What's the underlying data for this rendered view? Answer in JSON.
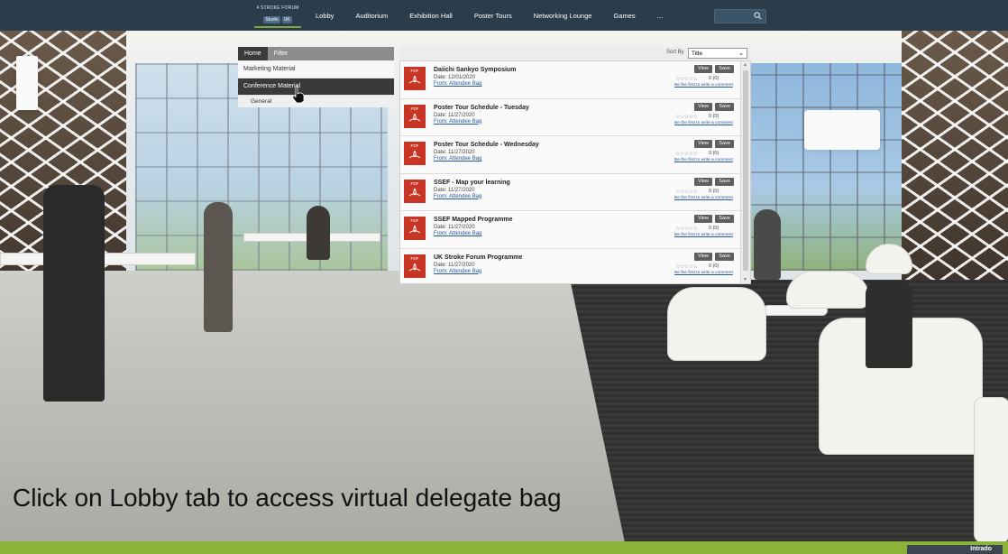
{
  "topnav": {
    "event_logo_text": "4 STROKE FORUM",
    "event_badges": [
      "Studio",
      "UK"
    ],
    "items": [
      {
        "label": "Lobby"
      },
      {
        "label": "Auditorium"
      },
      {
        "label": "Exhibition Hall"
      },
      {
        "label": "Poster Tours"
      },
      {
        "label": "Networking Lounge"
      },
      {
        "label": "Games"
      }
    ],
    "more_label": "...",
    "search_icon": "search-icon"
  },
  "bag": {
    "tabs": [
      {
        "label": "Home",
        "active": true
      },
      {
        "label": "Filter",
        "active": false
      }
    ],
    "menu": [
      {
        "label": "Marketing Material",
        "selected": false
      },
      {
        "label": "Conference Material",
        "selected": true
      }
    ],
    "submenu": [
      {
        "label": "General"
      }
    ]
  },
  "sort": {
    "label": "Sort By",
    "value": "Title"
  },
  "files": [
    {
      "title": "Daiichi Sankyo Symposium",
      "date": "Date: 12/01/2020",
      "from": "From: Attendee Bag",
      "rating": "0 (0)",
      "comment": "Be the first to write a comment"
    },
    {
      "title": "Poster Tour Schedule - Tuesday",
      "date": "Date: 11/27/2020",
      "from": "From: Attendee Bag",
      "rating": "0 (0)",
      "comment": "Be the first to write a comment"
    },
    {
      "title": "Poster Tour Schedule - Wednesday",
      "date": "Date: 11/27/2020",
      "from": "From: Attendee Bag",
      "rating": "0 (0)",
      "comment": "Be the first to write a comment"
    },
    {
      "title": "SSEF - Map your learning",
      "date": "Date: 11/27/2020",
      "from": "From: Attendee Bag",
      "rating": "0 (0)",
      "comment": "Be the first to write a comment"
    },
    {
      "title": "SSEF Mapped Programme",
      "date": "Date: 11/27/2020",
      "from": "From: Attendee Bag",
      "rating": "0 (0)",
      "comment": "Be the first to write a comment"
    },
    {
      "title": "UK Stroke Forum Programme",
      "date": "Date: 11/27/2020",
      "from": "From: Attendee Bag",
      "rating": "0 (0)",
      "comment": "Be the first to write a comment"
    }
  ],
  "file_buttons": {
    "view": "View",
    "save": "Save"
  },
  "pdf_label": "PDF",
  "stars": "☆☆☆☆☆",
  "caption": "Click on Lobby tab to access virtual delegate bag",
  "footer": {
    "brand": "Intrado"
  },
  "colors": {
    "nav_bg": "#2b3d4b",
    "accent_green": "#8bb33a",
    "pdf_red": "#c93524",
    "button_gray": "#5f5f5f",
    "link_blue": "#245a9a"
  }
}
